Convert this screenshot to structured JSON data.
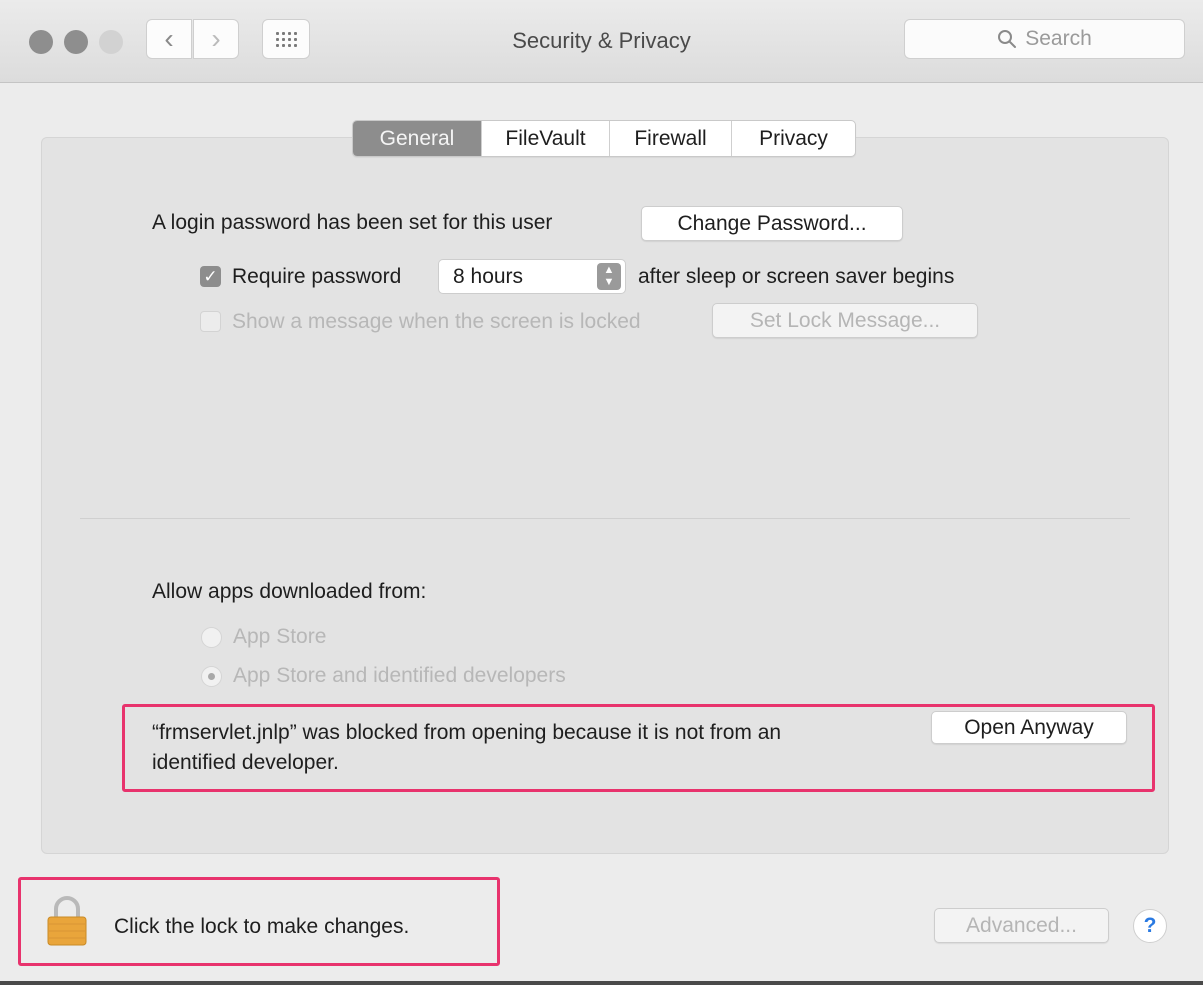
{
  "window": {
    "title": "Security & Privacy",
    "back_glyph": "‹",
    "forward_glyph": "›"
  },
  "search": {
    "placeholder": "Search",
    "icon": "magnifier"
  },
  "tabs": [
    {
      "label": "General",
      "active": true
    },
    {
      "label": "FileVault",
      "active": false
    },
    {
      "label": "Firewall",
      "active": false
    },
    {
      "label": "Privacy",
      "active": false
    }
  ],
  "general": {
    "login_text": "A login password has been set for this user",
    "change_password_button": "Change Password...",
    "require_password": {
      "checked": true,
      "label": "Require password",
      "select_value": "8 hours",
      "suffix": "after sleep or screen saver begins"
    },
    "show_message": {
      "checked": false,
      "enabled": false,
      "label": "Show a message when the screen is locked",
      "button": "Set Lock Message..."
    },
    "allow_apps": {
      "heading": "Allow apps downloaded from:",
      "options": [
        {
          "label": "App Store",
          "selected": false
        },
        {
          "label": "App Store and identified developers",
          "selected": true
        }
      ]
    },
    "blocked": {
      "line1": "“frmservlet.jnlp” was blocked from opening because it is not from an",
      "line2": "identified developer.",
      "button": "Open Anyway"
    }
  },
  "footer": {
    "lock_text": "Click the lock to make changes.",
    "advanced_button": "Advanced...",
    "help_label": "?"
  },
  "colors": {
    "highlight": "#e8336d",
    "help_accent": "#2a7ae2",
    "lock_gold": "#e9a53b"
  }
}
